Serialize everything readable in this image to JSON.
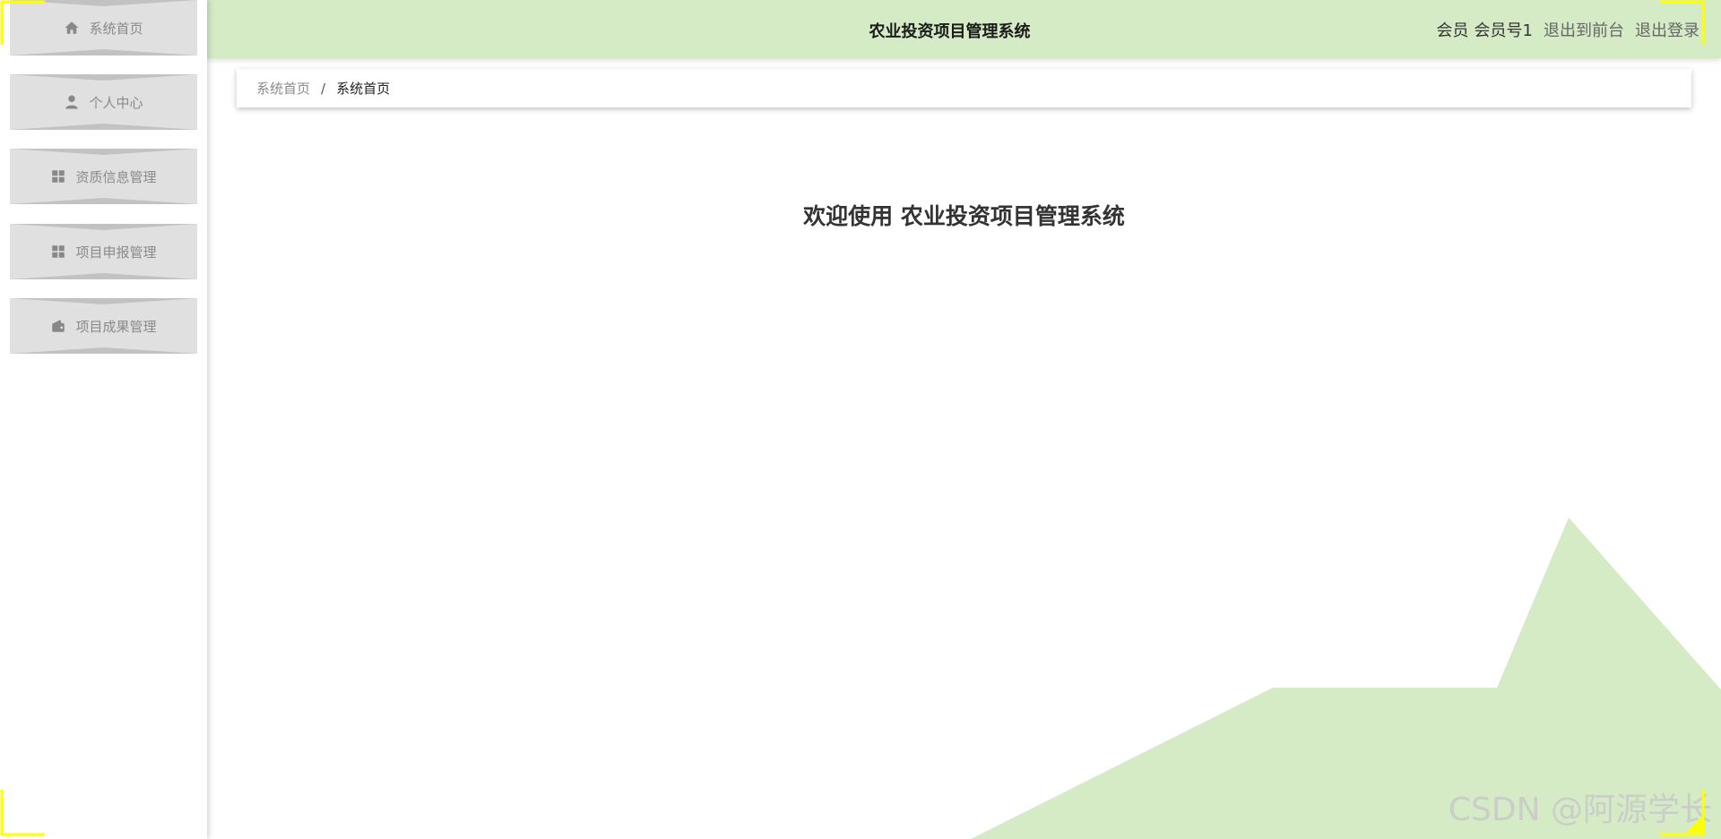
{
  "header": {
    "title": "农业投资项目管理系统",
    "user_role": "会员",
    "user_name": "会员号1",
    "back_front_label": "退出到前台",
    "logout_label": "退出登录"
  },
  "sidebar": {
    "items": [
      {
        "label": "系统首页",
        "icon": "home-icon"
      },
      {
        "label": "个人中心",
        "icon": "user-icon"
      },
      {
        "label": "资质信息管理",
        "icon": "grid-icon"
      },
      {
        "label": "项目申报管理",
        "icon": "grid-icon"
      },
      {
        "label": "项目成果管理",
        "icon": "wallet-icon"
      }
    ]
  },
  "breadcrumb": {
    "first": "系统首页",
    "separator": "/",
    "current": "系统首页"
  },
  "main": {
    "welcome": "欢迎使用 农业投资项目管理系统"
  },
  "watermark": "CSDN @阿源学长",
  "colors": {
    "accent_green": "#d4ebc5",
    "menu_bg": "#e0e0e0",
    "menu_notch": "#c2c2c2",
    "corner_highlight": "#ffff00"
  }
}
